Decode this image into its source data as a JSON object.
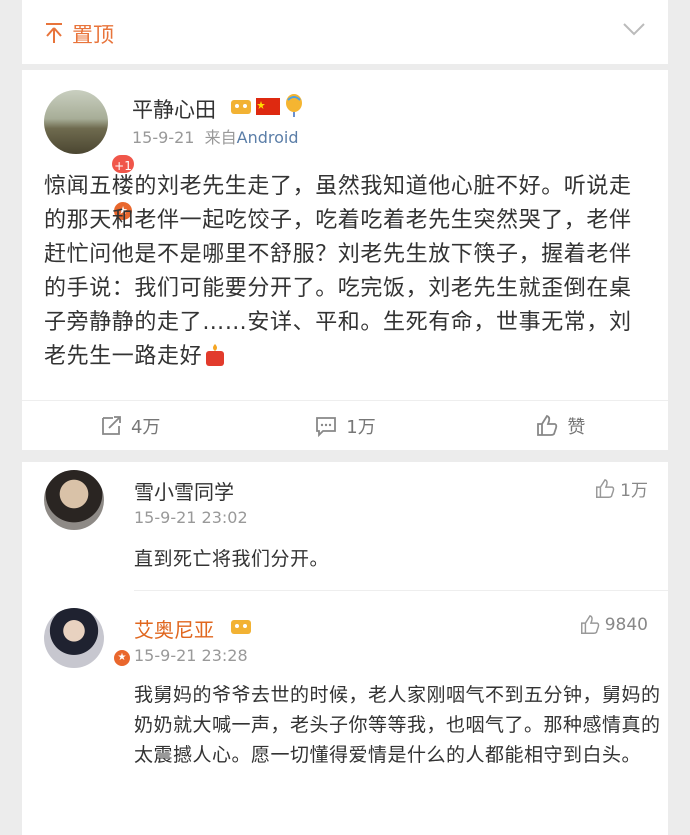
{
  "pin_bar": {
    "label": "置顶"
  },
  "post": {
    "username": "平静心田",
    "notify_badge": "+1",
    "date": "15-9-21",
    "source_prefix": "来自",
    "source": "Android",
    "text": "惊闻五楼的刘老先生走了，虽然我知道他心脏不好。听说走的那天和老伴一起吃饺子，吃着吃着老先生突然哭了，老伴赶忙问他是不是哪里不舒服？刘老先生放下筷子，握着老伴的手说：我们可能要分开了。吃完饭，刘老先生就歪倒在桌子旁静静的走了……安详、平和。生死有命，世事无常，刘老先生一路走好",
    "actions": {
      "repost": "4万",
      "comment": "1万",
      "like": "赞"
    }
  },
  "comments": [
    {
      "username": "雪小雪同学",
      "time": "15-9-21 23:02",
      "likes": "1万",
      "text": "直到死亡将我们分开。"
    },
    {
      "username": "艾奥尼亚",
      "time": "15-9-21 23:28",
      "likes": "9840",
      "text": "我舅妈的爷爷去世的时候，老人家刚咽气不到五分钟，舅妈的奶奶就大喊一声，老头子你等等我，也咽气了。那种感情真的太震撼人心。愿一切懂得爱情是什么的人都能相守到白头。"
    }
  ],
  "colors": {
    "accent_orange": "#e8743b",
    "username_orange": "#e0671f",
    "link_blue": "#5b7ea8",
    "muted": "#999999"
  }
}
